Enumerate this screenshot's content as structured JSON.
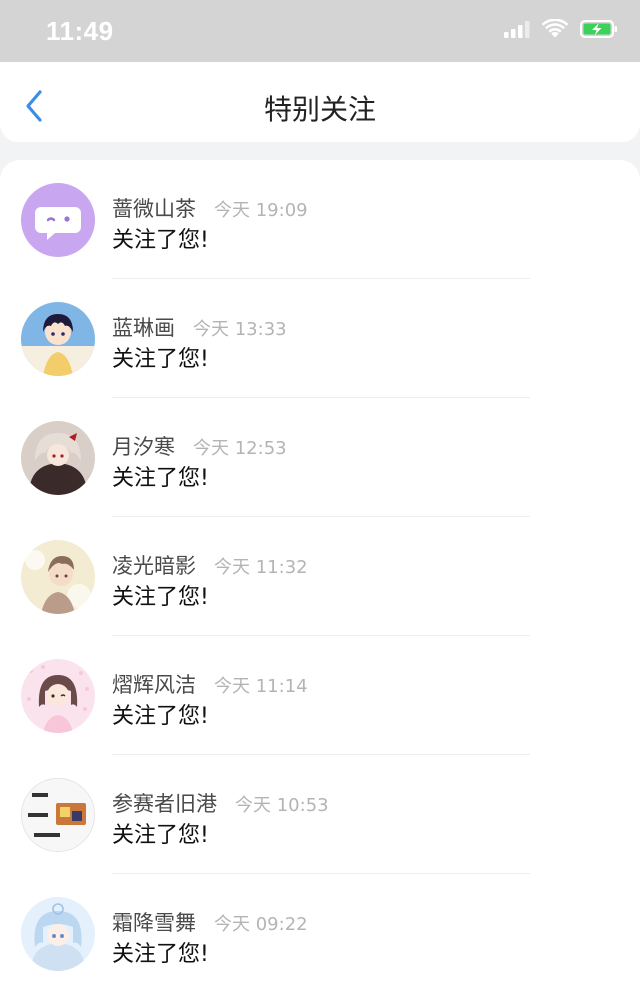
{
  "status_bar": {
    "time": "11:49",
    "icons": [
      "signal-icon",
      "wifi-icon",
      "battery-charging-icon"
    ],
    "battery_color": "#3cd25a"
  },
  "header": {
    "title": "特别关注",
    "back_icon": "chevron-left-icon",
    "accent_color": "#3a8ee6"
  },
  "followers": [
    {
      "name": "蔷微山茶",
      "time": "今天 19:09",
      "message": "关注了您!",
      "avatar_icon": "chat-bubble-avatar",
      "avatar_color": "#c9a6f0"
    },
    {
      "name": "蓝琳画",
      "time": "今天 13:33",
      "message": "关注了您!",
      "avatar_icon": "anime-boy-avatar",
      "avatar_color": "#6aa8e0"
    },
    {
      "name": "月汐寒",
      "time": "今天 12:53",
      "message": "关注了您!",
      "avatar_icon": "anime-girl-dark-avatar",
      "avatar_color": "#5a3a3a"
    },
    {
      "name": "凌光暗影",
      "time": "今天 11:32",
      "message": "关注了您!",
      "avatar_icon": "anime-boy-light-avatar",
      "avatar_color": "#e8d9b0"
    },
    {
      "name": "熠辉风洁",
      "time": "今天 11:14",
      "message": "关注了您!",
      "avatar_icon": "anime-girl-pink-avatar",
      "avatar_color": "#f4c9dc"
    },
    {
      "name": "参赛者旧港",
      "time": "今天 10:53",
      "message": "关注了您!",
      "avatar_icon": "sticker-collage-avatar",
      "avatar_color": "#e8e8e8"
    },
    {
      "name": "霜降雪舞",
      "time": "今天 09:22",
      "message": "关注了您!",
      "avatar_icon": "anime-girl-blue-avatar",
      "avatar_color": "#cfe4f7"
    }
  ]
}
